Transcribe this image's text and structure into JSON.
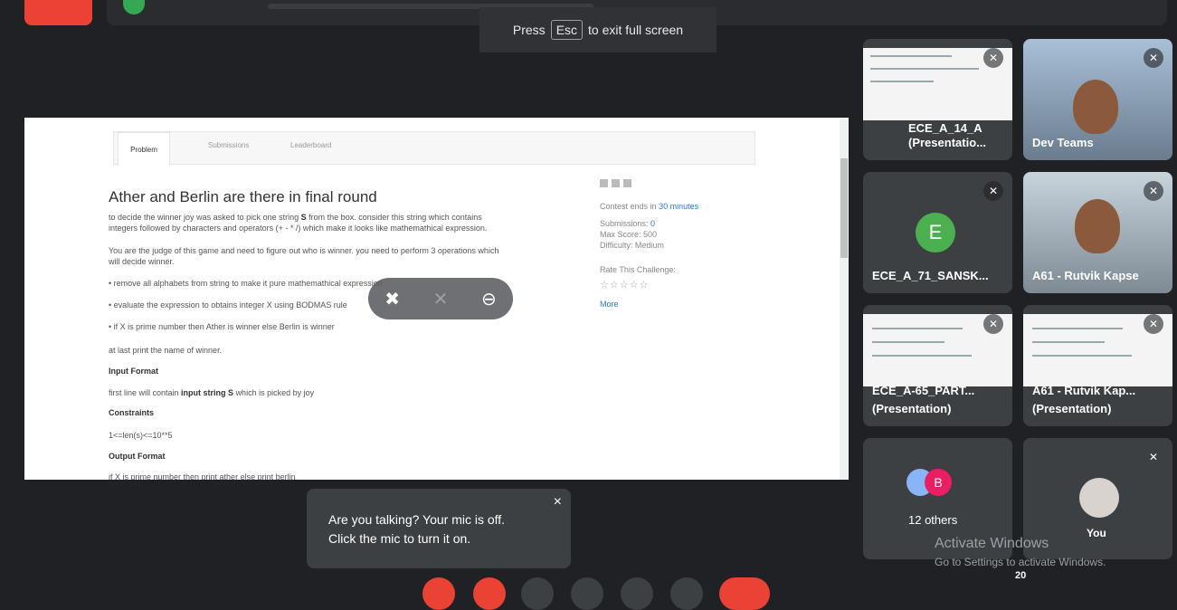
{
  "fullscreen": {
    "press": "Press",
    "key": "Esc",
    "suffix": "to exit full screen"
  },
  "shared_screen": {
    "tabs": [
      "Problem",
      "Submissions",
      "Leaderboard"
    ],
    "title": "Ather and Berlin are there in final round",
    "paragraph1a": "to decide the winner joy was asked to pick one string",
    "paragraph1b": "S",
    "paragraph1c": "from the box. consider this string which contains",
    "paragraph1d": "integers followed by characters and operators (+ - * /) which make it looks like mathemathical expression.",
    "paragraph2a": "You are the judge of this game and need to figure out who is winner. you need to perform 3 operations which",
    "paragraph2b": "will decide winner.",
    "bullets": [
      "remove all alphabets from string to make it pure mathemathical expression",
      "evaluate the expression to obtains integer X using BODMAS rule",
      "if X is prime number then Ather is winner else Berlin is winner"
    ],
    "last_line": "at last print the name of winner.",
    "input_heading": "Input Format",
    "input_text_a": "first line will contain",
    "input_text_b": "input string S",
    "input_text_c": "which is picked by joy",
    "constraints_heading": "Constraints",
    "constraints_text": "1<=len(s)<=10**5",
    "output_heading": "Output Format",
    "output_text": "if X is prime number then print ather else print berlin",
    "sidebar": {
      "contest_prefix": "Contest ends in",
      "contest_link": "30 minutes",
      "submissions_label": "Submissions:",
      "submissions_value": "0",
      "max_score": "Max Score: 500",
      "difficulty": "Difficulty: Medium",
      "rate": "Rate This Challenge:",
      "stars": "☆☆☆☆☆",
      "more": "More"
    }
  },
  "tiles": [
    {
      "name": "ECE_A_14_A",
      "name2": "(Presentatio..."
    },
    {
      "name": "Dev Teams"
    },
    {
      "name": "ECE_A_71_SANSK...",
      "avatar": "E"
    },
    {
      "name": "A61 - Rutvik Kapse"
    },
    {
      "name": "ECE_A-65_PART...",
      "name2": "(Presentation)"
    },
    {
      "name": "A61 - Rutvik Kap...",
      "name2": "(Presentation)"
    },
    {
      "name": "12 others",
      "avatar": "B"
    },
    {
      "name": "You"
    }
  ],
  "toast": {
    "line1": "Are you talking? Your mic is off.",
    "line2": "Click the mic to turn it on.",
    "close": "×"
  },
  "watermark": {
    "line1": "Activate Windows",
    "line2": "Go to Settings to activate Windows."
  },
  "participants_badge": "20",
  "colors": {
    "meet_bg": "#202124",
    "tile": "#3c4043",
    "danger": "#ea4335",
    "avatar_green": "#4caf50",
    "avatar_pink": "#e91e63"
  }
}
